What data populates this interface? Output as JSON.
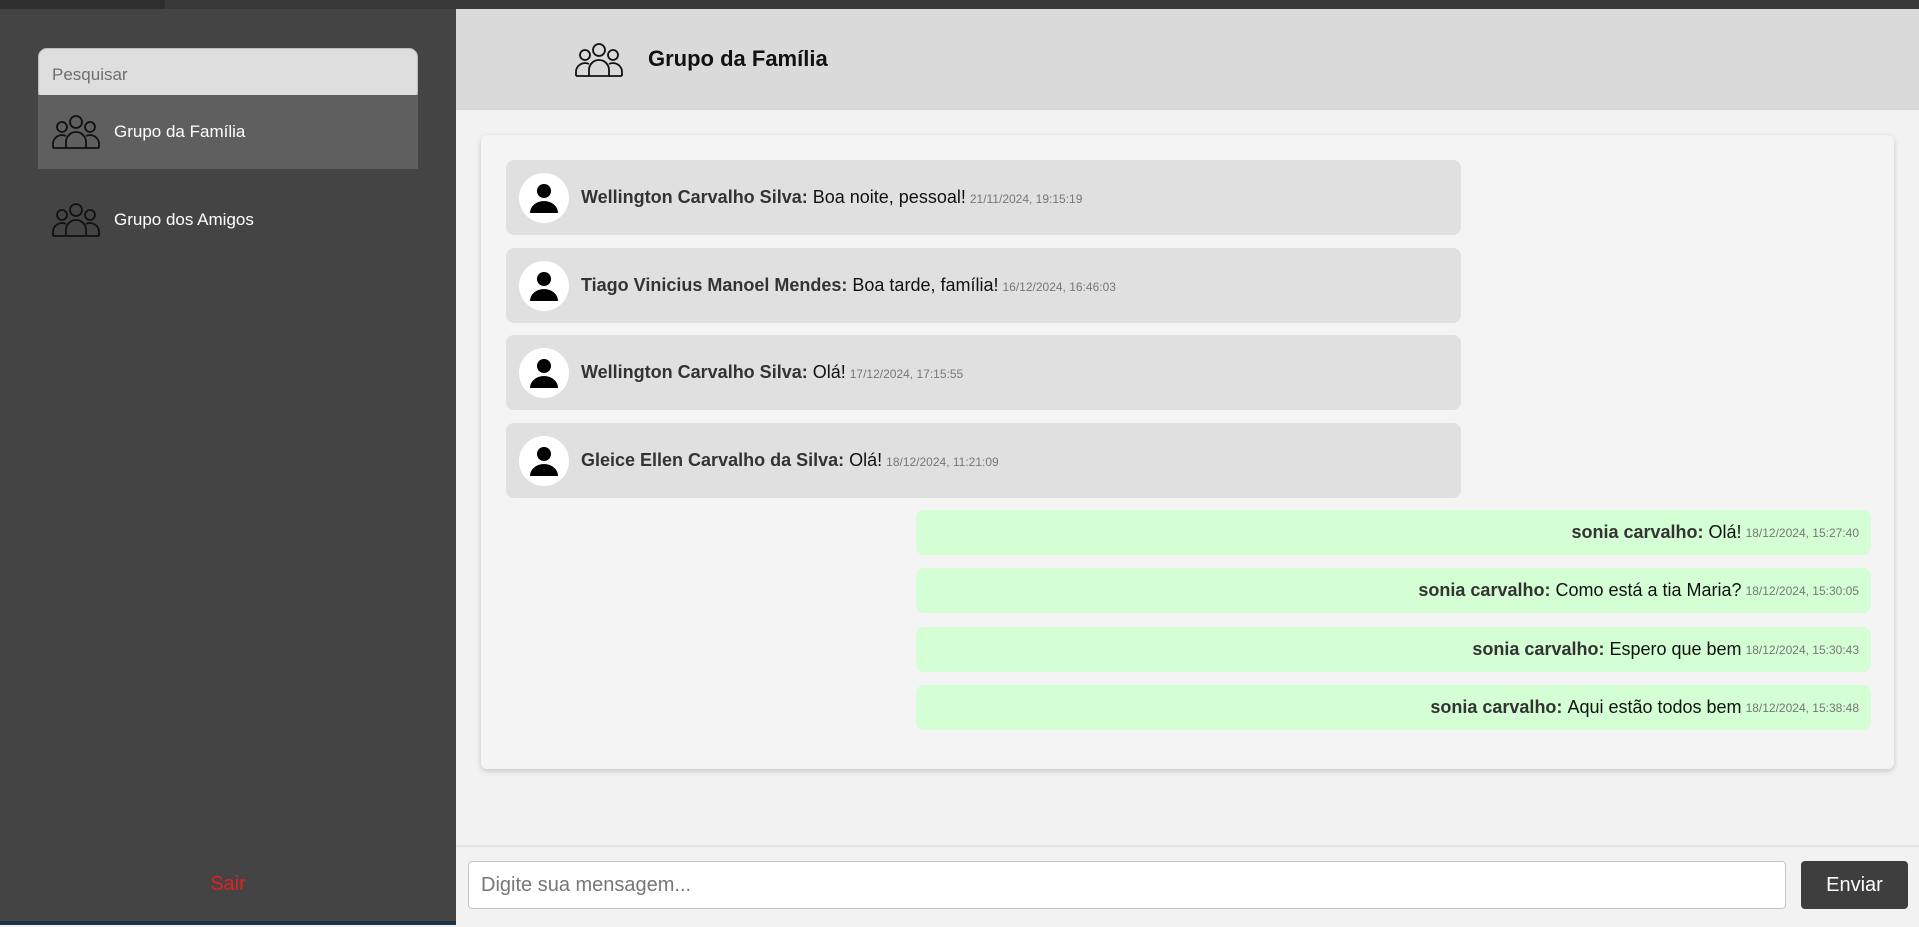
{
  "sidebar": {
    "search_placeholder": "Pesquisar",
    "groups": [
      {
        "label": "Grupo da Família",
        "icon": "group-icon",
        "active": true
      },
      {
        "label": "Grupo dos Amigos",
        "icon": "group-icon",
        "active": false
      }
    ],
    "logout_label": "Sair"
  },
  "header": {
    "title": "Grupo da Família",
    "icon": "group-icon"
  },
  "messages": [
    {
      "sender": "Wellington Carvalho Silva:",
      "text": "Boa noite, pessoal!",
      "time": "21/11/2024, 19:15:19"
    },
    {
      "sender": "Tiago Vinicius Manoel Mendes:",
      "text": "Boa tarde, família!",
      "time": "16/12/2024, 16:46:03"
    },
    {
      "sender": "Wellington Carvalho Silva:",
      "text": "Olá!",
      "time": "17/12/2024, 17:15:55"
    },
    {
      "sender": "Gleice Ellen Carvalho da Silva:",
      "text": "Olá!",
      "time": "18/12/2024, 11:21:09"
    }
  ],
  "own_messages": [
    {
      "sender": "sonia carvalho:",
      "text": "Olá!",
      "time": "18/12/2024, 15:27:40"
    },
    {
      "sender": "sonia carvalho:",
      "text": "Como está a tia Maria?",
      "time": "18/12/2024, 15:30:05"
    },
    {
      "sender": "sonia carvalho:",
      "text": "Espero que bem",
      "time": "18/12/2024, 15:30:43"
    },
    {
      "sender": "sonia carvalho:",
      "text": "Aqui estão todos bem",
      "time": "18/12/2024, 15:38:48"
    }
  ],
  "composer": {
    "placeholder": "Digite sua mensagem...",
    "send_label": "Enviar"
  },
  "colors": {
    "sidebar_bg": "#444444",
    "active_item": "#5f5f5f",
    "logout": "#e02121",
    "own_bubble": "#d4fed4",
    "other_bubble": "#e0e0e0",
    "send_button": "#3e3e3e"
  }
}
